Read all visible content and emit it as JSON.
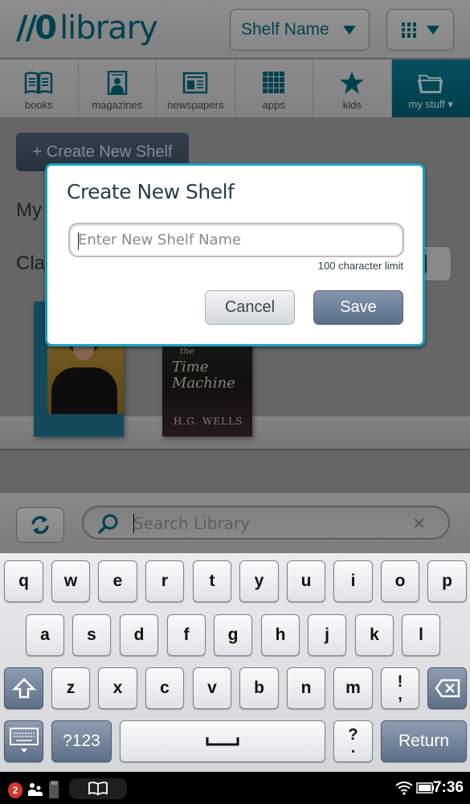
{
  "header": {
    "app_title": "library",
    "logo_mark": "//0",
    "shelf_select": "Shelf Name"
  },
  "tabs": [
    {
      "label": "books",
      "icon": "book-icon"
    },
    {
      "label": "magazines",
      "icon": "magazine-icon"
    },
    {
      "label": "newspapers",
      "icon": "newspaper-icon"
    },
    {
      "label": "apps",
      "icon": "apps-grid-icon"
    },
    {
      "label": "kids",
      "icon": "star-icon"
    },
    {
      "label": "my stuff ▾",
      "icon": "folder-icon",
      "active": true
    }
  ],
  "background": {
    "create_button": "+ Create New Shelf",
    "heading_my": "My",
    "heading_classics": "Cla",
    "books": [
      {
        "author": "",
        "title": ""
      },
      {
        "title_small": "the",
        "title": "Time Machine",
        "author": "H.G. WELLS"
      }
    ]
  },
  "dialog": {
    "title": "Create New Shelf",
    "input_placeholder": "Enter New Shelf Name",
    "input_value": "",
    "limit_text": "100 character limit",
    "cancel_label": "Cancel",
    "save_label": "Save"
  },
  "search": {
    "placeholder": "Search Library",
    "clear_label": "✕"
  },
  "keyboard": {
    "row1": [
      "q",
      "w",
      "e",
      "r",
      "t",
      "y",
      "u",
      "i",
      "o",
      "p"
    ],
    "row2": [
      "a",
      "s",
      "d",
      "f",
      "g",
      "h",
      "j",
      "k",
      "l"
    ],
    "row3": [
      "z",
      "x",
      "c",
      "v",
      "b",
      "n",
      "m"
    ],
    "punct_key": [
      "!",
      ","
    ],
    "question_key": [
      "?",
      "."
    ],
    "numbers_label": "?123",
    "return_label": "Return"
  },
  "statusbar": {
    "notification_count": "2",
    "time": "7:36"
  }
}
